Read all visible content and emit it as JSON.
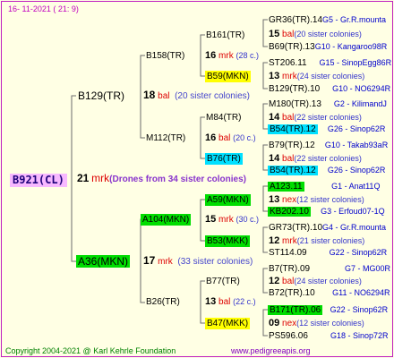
{
  "header": {
    "date": "16- 11-2021 ( 21:  9)"
  },
  "footer": {
    "copyright": "Copyright 2004-2021 @ Karl Kehrle Foundation",
    "site": "www.pedigreeapis.org"
  },
  "root": {
    "name": "B921(CL)",
    "count": "21",
    "rel": "mrk",
    "note": "(Drones from 34 sister colonies)"
  },
  "gen1": {
    "upper": {
      "name": "B129(TR)",
      "count": "18",
      "rel": "bal",
      "note": "(20 sister colonies)"
    },
    "lower": {
      "name": "A36(MKN)",
      "count": "17",
      "rel": "mrk",
      "note": "(33 sister colonies)"
    }
  },
  "gen2": {
    "b158": {
      "name": "B158(TR)",
      "count": "16",
      "rel": "mrk",
      "note": "(28 c.)"
    },
    "m112": {
      "name": "M112(TR)",
      "count": "16",
      "rel": "bal",
      "note": "(20 c.)"
    },
    "a104": {
      "name": "A104(MKN)",
      "count": "15",
      "rel": "mrk",
      "note": "(30 c.)"
    },
    "b26": {
      "name": "B26(TR)",
      "count": "13",
      "rel": "bal",
      "note": "(22 c.)"
    }
  },
  "gen3": {
    "b161": {
      "name": "B161(TR)"
    },
    "b59": {
      "name": "B59(MKN)"
    },
    "m84": {
      "name": "M84(TR)"
    },
    "b76": {
      "name": "B76(TR)"
    },
    "a59": {
      "name": "A59(MKN)"
    },
    "b53": {
      "name": "B53(MKK)"
    },
    "b77": {
      "name": "B77(TR)"
    },
    "b47": {
      "name": "B47(MKK)"
    }
  },
  "gen4": {
    "r1": {
      "name": "GR36(TR).14",
      "code": "G5 - Gr.R.mounta"
    },
    "r1m": {
      "count": "15",
      "rel": "bal",
      "note": "(20 sister colonies)"
    },
    "r2": {
      "name": "B69(TR).13",
      "code": "G10 - Kangaroo98R"
    },
    "r3": {
      "name": "ST206.11",
      "code": "G15 - SinopEgg86R"
    },
    "r3m": {
      "count": "13",
      "rel": "mrk",
      "note": "(24 sister colonies)"
    },
    "r4": {
      "name": "B129(TR).10",
      "code": "G10 - NO6294R"
    },
    "r5": {
      "name": "M180(TR).13",
      "code": "G2 - KilimandJ"
    },
    "r5m": {
      "count": "14",
      "rel": "bal",
      "note": "(22 sister colonies)"
    },
    "r6": {
      "name": "B54(TR).12",
      "code": "G26 - Sinop62R"
    },
    "r7": {
      "name": "B79(TR).12",
      "code": "G10 - Takab93aR"
    },
    "r7m": {
      "count": "14",
      "rel": "bal",
      "note": "(22 sister colonies)"
    },
    "r8": {
      "name": "B54(TR).12",
      "code": "G26 - Sinop62R"
    },
    "r9": {
      "name": "A123.11",
      "code": "G1 - Anat11Q"
    },
    "r9m": {
      "count": "13",
      "rel": "nex",
      "note": "(12 sister colonies)"
    },
    "r10": {
      "name": "KB202.10",
      "code": "G3 - Erfoud07-1Q"
    },
    "r11": {
      "name": "GR73(TR).10",
      "code": "G4 - Gr.R.mounta"
    },
    "r11m": {
      "count": "12",
      "rel": "mrk",
      "note": "(21 sister colonies)"
    },
    "r12": {
      "name": "ST114.09",
      "code": "G22 - Sinop62R"
    },
    "r13": {
      "name": "B7(TR).09",
      "code": "G7 - MG00R"
    },
    "r13m": {
      "count": "12",
      "rel": "bal",
      "note": "(24 sister colonies)"
    },
    "r14": {
      "name": "B72(TR).10",
      "code": "G11 - NO6294R"
    },
    "r15": {
      "name": "B171(TR).06",
      "code": "G22 - Sinop62R"
    },
    "r15m": {
      "count": "09",
      "rel": "nex",
      "note": "(12 sister colonies)"
    },
    "r16": {
      "name": "PS596.06",
      "code": "G18 - Sinop72R"
    }
  },
  "colors": {
    "root_bg": "#F7B8FF",
    "green": "#00DD00",
    "yellow": "#FFFF00",
    "cyan": "#00E0FF",
    "relation": "#DD0000",
    "colonies": "#3333CC",
    "code": "#0000CC",
    "frame": "#C020C0"
  }
}
